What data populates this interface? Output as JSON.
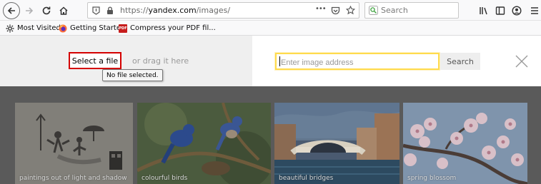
{
  "browser": {
    "url_prefix": "https://",
    "url_host": "yandex.com",
    "url_path": "/images/",
    "search_placeholder": "Search",
    "more_label": "•••"
  },
  "bookmarks": [
    {
      "label": "Most Visited",
      "icon": "gear-icon"
    },
    {
      "label": "Getting Started",
      "icon": "firefox-icon"
    },
    {
      "label": "Compress your PDF fil...",
      "icon": "pdf-icon",
      "badge": "PDF"
    }
  ],
  "upload": {
    "select_file_label": "Select a file",
    "drag_text": "or drag it here",
    "tooltip": "No file selected.",
    "image_address_placeholder": "Enter image address",
    "search_label": "Search"
  },
  "gallery": {
    "tiles": [
      {
        "caption": "paintings out of light and shadow"
      },
      {
        "caption": "colourful birds"
      },
      {
        "caption": "beautiful bridges"
      },
      {
        "caption": "spring blossom"
      }
    ]
  },
  "colors": {
    "select_border": "#d40000",
    "input_border": "#ffdb4d",
    "overlay": "#5a5a5a"
  }
}
